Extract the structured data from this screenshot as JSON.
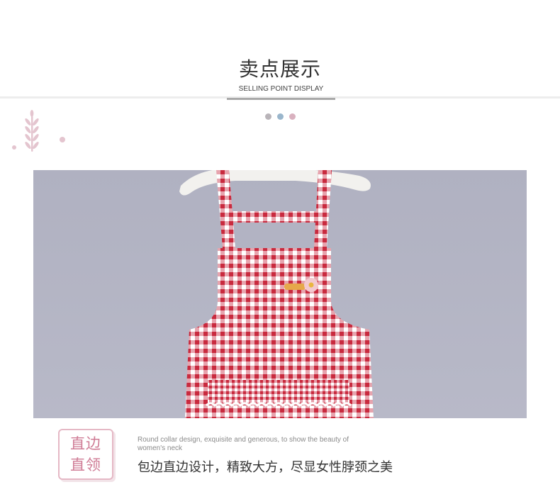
{
  "header": {
    "title": "卖点展示",
    "subtitle": "SELLING POINT DISPLAY"
  },
  "colors": {
    "dot_1": "#b9b4b9",
    "dot_2": "#9ab6cc",
    "dot_3": "#d9b1bf",
    "accent_pink": "#cf7b95",
    "plaid_red": "#c92a3e"
  },
  "icons": {
    "decoration": "wheat-sprig-icon"
  },
  "feature": {
    "badge_line_1": "直边",
    "badge_line_2": "直领",
    "english_text": "Round collar design, exquisite and generous, to show the beauty of women's neck",
    "chinese_text": "包边直边设计，精致大方，尽显女性脖颈之美"
  }
}
